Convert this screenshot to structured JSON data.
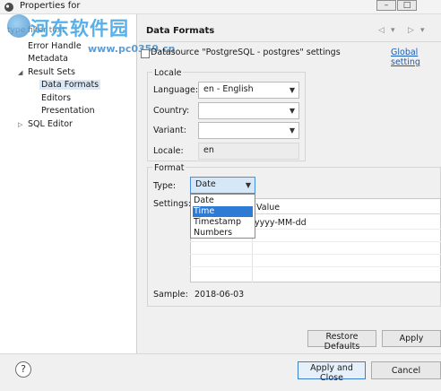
{
  "window": {
    "title": "Properties for",
    "controls": {
      "minimize": "–",
      "maximize": "□"
    }
  },
  "watermark": {
    "title": "河东软件园",
    "url": "www.pc0359.cn"
  },
  "sidebar": {
    "filter_placeholder": "type filter text",
    "items": [
      {
        "label": "Error Handle"
      },
      {
        "label": "Metadata"
      },
      {
        "label": "Result Sets",
        "twisty": "◢"
      },
      {
        "label": "Data Formats",
        "selected": true
      },
      {
        "label": "Editors"
      },
      {
        "label": "Presentation"
      },
      {
        "label": "SQL Editor",
        "twisty": "▷"
      }
    ]
  },
  "header": {
    "title": "Data Formats",
    "nav": {
      "back": "◁",
      "back_menu": "▾",
      "forward": "▷",
      "forward_menu": "▾"
    }
  },
  "datasource": {
    "label": "Datasource \"PostgreSQL - postgres\" settings",
    "checked": false,
    "global_link": "Global setting"
  },
  "locale_group": {
    "title": "Locale",
    "language_label": "Language:",
    "language_value": "en - English",
    "country_label": "Country:",
    "country_value": "",
    "variant_label": "Variant:",
    "variant_value": "",
    "locale_label": "Locale:",
    "locale_value": "en",
    "arrow": "▼"
  },
  "format_group": {
    "title": "Format",
    "type_label": "Type:",
    "type_value": "Date",
    "type_options": [
      "Date",
      "Time",
      "Timestamp",
      "Numbers"
    ],
    "highlighted_option": "Time",
    "settings_label": "Settings:",
    "table": {
      "value_header": "Value",
      "rows": [
        {
          "value": "yyyy-MM-dd"
        }
      ]
    },
    "sample_label": "Sample:",
    "sample_value": "2018-06-03"
  },
  "buttons": {
    "restore_defaults": "Restore Defaults",
    "apply": "Apply",
    "apply_and_close": "Apply and Close",
    "cancel": "Cancel",
    "help": "?"
  },
  "colors": {
    "selection": "#d9e8f7",
    "highlight": "#2e7bd6",
    "link": "#1b5bb8",
    "watermark": "#3aa3e3"
  }
}
